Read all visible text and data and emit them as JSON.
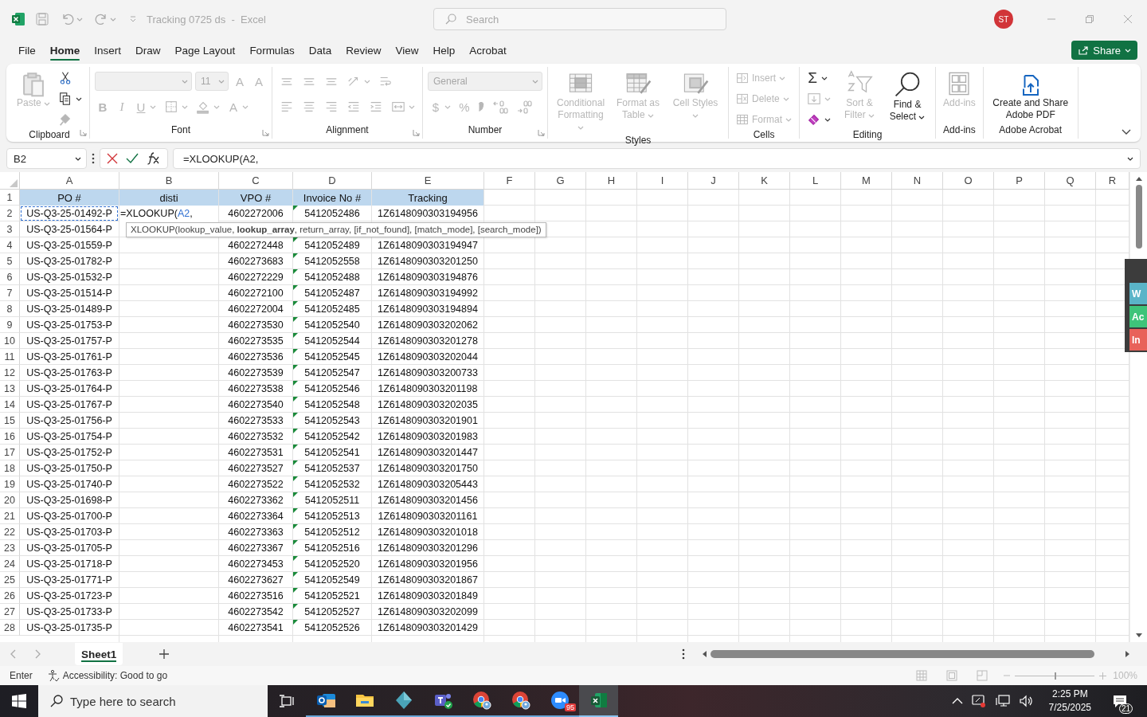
{
  "title_bar": {
    "title": "Tracking 0725 ds  -  Excel",
    "search": {
      "placeholder": "Search"
    },
    "avatar": "ST"
  },
  "tabs": [
    {
      "label": "File",
      "selected": false
    },
    {
      "label": "Home",
      "selected": true
    },
    {
      "label": "Insert",
      "selected": false
    },
    {
      "label": "Draw",
      "selected": false
    },
    {
      "label": "Page Layout",
      "selected": false
    },
    {
      "label": "Formulas",
      "selected": false
    },
    {
      "label": "Data",
      "selected": false
    },
    {
      "label": "Review",
      "selected": false
    },
    {
      "label": "View",
      "selected": false
    },
    {
      "label": "Help",
      "selected": false
    },
    {
      "label": "Acrobat",
      "selected": false
    }
  ],
  "share": "Share",
  "ribbon": [
    {
      "kind": "clipboard",
      "label": "Clipboard",
      "launcher": true,
      "sections": [
        {
          "kind": "large",
          "items": [
            {
              "kind": "paste",
              "label": "Paste",
              "disabled": true,
              "dropdown": true
            }
          ]
        },
        {
          "kind": "stack",
          "items": [
            {
              "kind": "cut",
              "disabled": false,
              "dropdown": false
            },
            {
              "kind": "copy",
              "disabled": false,
              "dropdown": true
            },
            {
              "kind": "painter",
              "disabled": true,
              "dropdown": false
            }
          ]
        }
      ]
    },
    {
      "kind": "font",
      "label": "Font",
      "launcher": true,
      "sections": [
        {
          "kind": "rows",
          "top": [
            {
              "kind": "combo",
              "disabled": true
            },
            {
              "kind": "combo-small",
              "value": "11",
              "disabled": true
            },
            {
              "kind": "grow",
              "glyph": "A",
              "disabled": true,
              "dropdown": false
            },
            {
              "kind": "shrink",
              "glyph": "A",
              "disabled": true,
              "dropdown": false
            }
          ],
          "bottom": [
            {
              "kind": "bold",
              "glyph": "B",
              "disabled": true,
              "dropdown": false
            },
            {
              "kind": "italic",
              "glyph": "I",
              "disabled": true,
              "dropdown": false
            },
            {
              "kind": "underline",
              "glyph": "U",
              "disabled": true,
              "dropdown": true
            },
            {
              "kind": "borders",
              "disabled": true,
              "dropdown": true
            },
            {
              "kind": "fill",
              "disabled": true,
              "dropdown": true
            },
            {
              "kind": "fontcolor",
              "glyph": "A",
              "disabled": true,
              "dropdown": true
            }
          ]
        }
      ]
    },
    {
      "kind": "alignment",
      "label": "Alignment",
      "launcher": true,
      "sections": [
        {
          "kind": "rows",
          "top": [
            {
              "kind": "align-top",
              "disabled": true,
              "dropdown": false
            },
            {
              "kind": "align-middle",
              "disabled": true,
              "dropdown": false
            },
            {
              "kind": "align-bottom",
              "disabled": true,
              "dropdown": false
            },
            {
              "kind": "orientation",
              "disabled": true,
              "dropdown": true
            },
            {
              "kind": "wrap",
              "disabled": true,
              "dropdown": false
            }
          ],
          "bottom": [
            {
              "kind": "align-left",
              "disabled": true,
              "dropdown": false
            },
            {
              "kind": "align-center",
              "disabled": true,
              "dropdown": false
            },
            {
              "kind": "align-right",
              "disabled": true,
              "dropdown": false
            },
            {
              "kind": "outdent",
              "disabled": true,
              "dropdown": false
            },
            {
              "kind": "indent",
              "disabled": true,
              "dropdown": false
            },
            {
              "kind": "merge",
              "disabled": true,
              "dropdown": true
            }
          ]
        }
      ]
    },
    {
      "kind": "number",
      "label": "Number",
      "launcher": true,
      "sections": [
        {
          "kind": "rows",
          "top": [
            {
              "kind": "combo-wide",
              "value": "General",
              "disabled": true
            }
          ],
          "bottom": [
            {
              "kind": "currency",
              "glyph": "$",
              "disabled": true,
              "dropdown": true
            },
            {
              "kind": "percent",
              "glyph": "%",
              "disabled": true,
              "dropdown": false
            },
            {
              "kind": "comma",
              "disabled": true,
              "dropdown": false
            },
            {
              "kind": "inc-decimal",
              "disabled": true,
              "dropdown": false
            },
            {
              "kind": "dec-decimal",
              "disabled": true,
              "dropdown": false
            }
          ]
        }
      ]
    },
    {
      "kind": "styles",
      "label": "Styles",
      "launcher": false,
      "sections": [
        {
          "kind": "large",
          "items": [
            {
              "kind": "conditional",
              "label": "Conditional Formatting",
              "disabled": true,
              "dropdown": true
            },
            {
              "kind": "table",
              "label": "Format as Table",
              "disabled": true,
              "dropdown": true
            },
            {
              "kind": "cellstyles",
              "label": "Cell Styles",
              "disabled": true,
              "dropdown": true
            }
          ]
        }
      ]
    },
    {
      "kind": "cells",
      "label": "Cells",
      "launcher": false,
      "sections": [
        {
          "kind": "stack",
          "items": [
            {
              "kind": "insert",
              "label": "Insert",
              "disabled": true,
              "dropdown": true
            },
            {
              "kind": "delete",
              "label": "Delete",
              "disabled": true,
              "dropdown": true
            },
            {
              "kind": "format",
              "label": "Format",
              "disabled": true,
              "dropdown": true
            }
          ]
        }
      ]
    },
    {
      "kind": "editing",
      "label": "Editing",
      "launcher": false,
      "sections": [
        {
          "kind": "stack",
          "items": [
            {
              "kind": "sum",
              "glyph": "Σ",
              "disabled": false,
              "dropdown": true
            },
            {
              "kind": "filldown",
              "disabled": true,
              "dropdown": true
            },
            {
              "kind": "clear",
              "disabled": false,
              "dropdown": true
            }
          ]
        },
        {
          "kind": "large",
          "items": [
            {
              "kind": "sort",
              "label": "Sort & Filter",
              "disabled": true,
              "dropdown": true
            },
            {
              "kind": "find",
              "label": "Find & Select",
              "disabled": false,
              "dropdown": true
            }
          ]
        }
      ]
    },
    {
      "kind": "addins",
      "label": "Add-ins",
      "launcher": false,
      "sections": [
        {
          "kind": "large",
          "items": [
            {
              "kind": "addins",
              "label": "Add-ins",
              "disabled": true,
              "dropdown": false
            }
          ]
        }
      ]
    },
    {
      "kind": "acrobat",
      "label": "Adobe Acrobat",
      "launcher": false,
      "sections": [
        {
          "kind": "large",
          "items": [
            {
              "kind": "pdf",
              "label": "Create and Share Adobe PDF",
              "disabled": false,
              "dropdown": false
            }
          ]
        }
      ]
    }
  ],
  "formula_bar": {
    "name_box": "B2",
    "formula": "=XLOOKUP(A2,"
  },
  "column_letters": [
    "A",
    "B",
    "C",
    "D",
    "E",
    "F",
    "G",
    "H",
    "I",
    "J",
    "K",
    "L",
    "M",
    "N",
    "O",
    "P",
    "Q",
    "R"
  ],
  "header_row": {
    "n": "1",
    "cells": [
      "PO #",
      "disti",
      "VPO #",
      "Invoice No #",
      "Tracking"
    ]
  },
  "editing_cell": {
    "prefix": "=XLOOKUP(",
    "ref": "A2",
    "suffix": ","
  },
  "tooltip": "XLOOKUP(lookup_value, **lookup_array**, return_array, [if_not_found], [match_mode], [search_mode])",
  "rows": [
    {
      "n": "2",
      "ref": true,
      "flagged": true,
      "po": "US-Q3-25-01492-P",
      "vpo": "4602272006",
      "invoice": "5412052486",
      "tracking": "1Z6148090303194956"
    },
    {
      "n": "3",
      "ref": false,
      "flagged": false,
      "po": "US-Q3-25-01564-P"
    },
    {
      "n": "4",
      "ref": false,
      "flagged": true,
      "po": "US-Q3-25-01559-P",
      "vpo": "4602272448",
      "invoice": "5412052489",
      "tracking": "1Z6148090303194947"
    },
    {
      "n": "5",
      "ref": false,
      "flagged": true,
      "po": "US-Q3-25-01782-P",
      "vpo": "4602273683",
      "invoice": "5412052558",
      "tracking": "1Z6148090303201250"
    },
    {
      "n": "6",
      "ref": false,
      "flagged": true,
      "po": "US-Q3-25-01532-P",
      "vpo": "4602272229",
      "invoice": "5412052488",
      "tracking": "1Z6148090303194876"
    },
    {
      "n": "7",
      "ref": false,
      "flagged": true,
      "po": "US-Q3-25-01514-P",
      "vpo": "4602272100",
      "invoice": "5412052487",
      "tracking": "1Z6148090303194992"
    },
    {
      "n": "8",
      "ref": false,
      "flagged": true,
      "po": "US-Q3-25-01489-P",
      "vpo": "4602272004",
      "invoice": "5412052485",
      "tracking": "1Z6148090303194894"
    },
    {
      "n": "9",
      "ref": false,
      "flagged": true,
      "po": "US-Q3-25-01753-P",
      "vpo": "4602273530",
      "invoice": "5412052540",
      "tracking": "1Z6148090303202062"
    },
    {
      "n": "10",
      "ref": false,
      "flagged": true,
      "po": "US-Q3-25-01757-P",
      "vpo": "4602273535",
      "invoice": "5412052544",
      "tracking": "1Z6148090303201278"
    },
    {
      "n": "11",
      "ref": false,
      "flagged": true,
      "po": "US-Q3-25-01761-P",
      "vpo": "4602273536",
      "invoice": "5412052545",
      "tracking": "1Z6148090303202044"
    },
    {
      "n": "12",
      "ref": false,
      "flagged": true,
      "po": "US-Q3-25-01763-P",
      "vpo": "4602273539",
      "invoice": "5412052547",
      "tracking": "1Z6148090303200733"
    },
    {
      "n": "13",
      "ref": false,
      "flagged": true,
      "po": "US-Q3-25-01764-P",
      "vpo": "4602273538",
      "invoice": "5412052546",
      "tracking": "1Z6148090303201198"
    },
    {
      "n": "14",
      "ref": false,
      "flagged": true,
      "po": "US-Q3-25-01767-P",
      "vpo": "4602273540",
      "invoice": "5412052548",
      "tracking": "1Z6148090303202035"
    },
    {
      "n": "15",
      "ref": false,
      "flagged": true,
      "po": "US-Q3-25-01756-P",
      "vpo": "4602273533",
      "invoice": "5412052543",
      "tracking": "1Z6148090303201901"
    },
    {
      "n": "16",
      "ref": false,
      "flagged": true,
      "po": "US-Q3-25-01754-P",
      "vpo": "4602273532",
      "invoice": "5412052542",
      "tracking": "1Z6148090303201983"
    },
    {
      "n": "17",
      "ref": false,
      "flagged": true,
      "po": "US-Q3-25-01752-P",
      "vpo": "4602273531",
      "invoice": "5412052541",
      "tracking": "1Z6148090303201447"
    },
    {
      "n": "18",
      "ref": false,
      "flagged": true,
      "po": "US-Q3-25-01750-P",
      "vpo": "4602273527",
      "invoice": "5412052537",
      "tracking": "1Z6148090303201750"
    },
    {
      "n": "19",
      "ref": false,
      "flagged": true,
      "po": "US-Q3-25-01740-P",
      "vpo": "4602273522",
      "invoice": "5412052532",
      "tracking": "1Z6148090303205443"
    },
    {
      "n": "20",
      "ref": false,
      "flagged": true,
      "po": "US-Q3-25-01698-P",
      "vpo": "4602273362",
      "invoice": "5412052511",
      "tracking": "1Z6148090303201456"
    },
    {
      "n": "21",
      "ref": false,
      "flagged": true,
      "po": "US-Q3-25-01700-P",
      "vpo": "4602273364",
      "invoice": "5412052513",
      "tracking": "1Z6148090303201161"
    },
    {
      "n": "22",
      "ref": false,
      "flagged": true,
      "po": "US-Q3-25-01703-P",
      "vpo": "4602273363",
      "invoice": "5412052512",
      "tracking": "1Z6148090303201018"
    },
    {
      "n": "23",
      "ref": false,
      "flagged": true,
      "po": "US-Q3-25-01705-P",
      "vpo": "4602273367",
      "invoice": "5412052516",
      "tracking": "1Z6148090303201296"
    },
    {
      "n": "24",
      "ref": false,
      "flagged": true,
      "po": "US-Q3-25-01718-P",
      "vpo": "4602273453",
      "invoice": "5412052520",
      "tracking": "1Z6148090303201956"
    },
    {
      "n": "25",
      "ref": false,
      "flagged": true,
      "po": "US-Q3-25-01771-P",
      "vpo": "4602273627",
      "invoice": "5412052549",
      "tracking": "1Z6148090303201867"
    },
    {
      "n": "26",
      "ref": false,
      "flagged": true,
      "po": "US-Q3-25-01723-P",
      "vpo": "4602273516",
      "invoice": "5412052521",
      "tracking": "1Z6148090303201849"
    },
    {
      "n": "27",
      "ref": false,
      "flagged": true,
      "po": "US-Q3-25-01733-P",
      "vpo": "4602273542",
      "invoice": "5412052527",
      "tracking": "1Z6148090303202099"
    },
    {
      "n": "28",
      "ref": false,
      "flagged": true,
      "po": "US-Q3-25-01735-P",
      "vpo": "4602273541",
      "invoice": "5412052526",
      "tracking": "1Z6148090303201429"
    }
  ],
  "side_panel": [
    {
      "label": "W",
      "color": "#5ab4c8"
    },
    {
      "label": "Ac",
      "color": "#3ec47a"
    },
    {
      "label": "In",
      "color": "#e8625a"
    }
  ],
  "sheet_tabs": [
    {
      "label": "Sheet1",
      "selected": true
    }
  ],
  "status_bar": {
    "mode": "Enter",
    "accessibility": "Accessibility: Good to go",
    "zoom": "100%",
    "zoom_slider": {
      "level": 0.5
    }
  },
  "taskbar": {
    "search": {
      "placeholder": "Type here to search"
    },
    "apps": [
      {
        "kind": "outlook",
        "active": false
      },
      {
        "kind": "explorer",
        "active": false
      },
      {
        "kind": "diamond",
        "active": false
      },
      {
        "kind": "teams",
        "active": false
      },
      {
        "kind": "chrome",
        "active": false
      },
      {
        "kind": "chrome",
        "active": false
      },
      {
        "kind": "zoom",
        "active": false,
        "badge": "95"
      },
      {
        "kind": "excel",
        "active": true
      }
    ],
    "time": "2:25 PM",
    "date": "7/25/2025",
    "notifications": "21"
  }
}
